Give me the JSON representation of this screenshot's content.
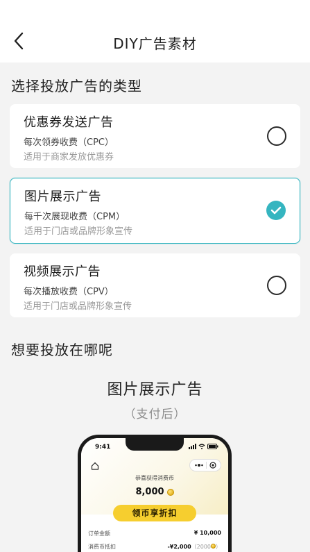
{
  "header": {
    "title": "DIY广告素材"
  },
  "section_type": {
    "title": "选择投放广告的类型"
  },
  "ad_types": [
    {
      "title": "优惠券发送广告",
      "billing": "每次领券收费（CPC）",
      "usage": "适用于商家发放优惠券",
      "selected": false
    },
    {
      "title": "图片展示广告",
      "billing": "每千次展现收费（CPM）",
      "usage": "适用于门店或品牌形象宣传",
      "selected": true
    },
    {
      "title": "视频展示广告",
      "billing": "每次播放收费（CPV）",
      "usage": "适用于门店或品牌形象宣传",
      "selected": false
    }
  ],
  "section_placement": {
    "title": "想要投放在哪呢"
  },
  "preview": {
    "title": "图片展示广告",
    "subtitle": "（支付后）",
    "phone": {
      "time": "9:41",
      "earn_label": "恭喜获得消费币",
      "coin_amount": "8,000",
      "button_label": "领币享折扣",
      "order_label": "订单金额",
      "order_value": "¥ 10,000",
      "deduct_label": "消费币抵扣",
      "deduct_value": "-¥2,000",
      "deduct_note": "（2000",
      "deduct_note_end": "）"
    }
  },
  "colors": {
    "accent": "#35b5c0",
    "button_yellow": "#f6ce2f",
    "background": "#f3f3f3"
  }
}
